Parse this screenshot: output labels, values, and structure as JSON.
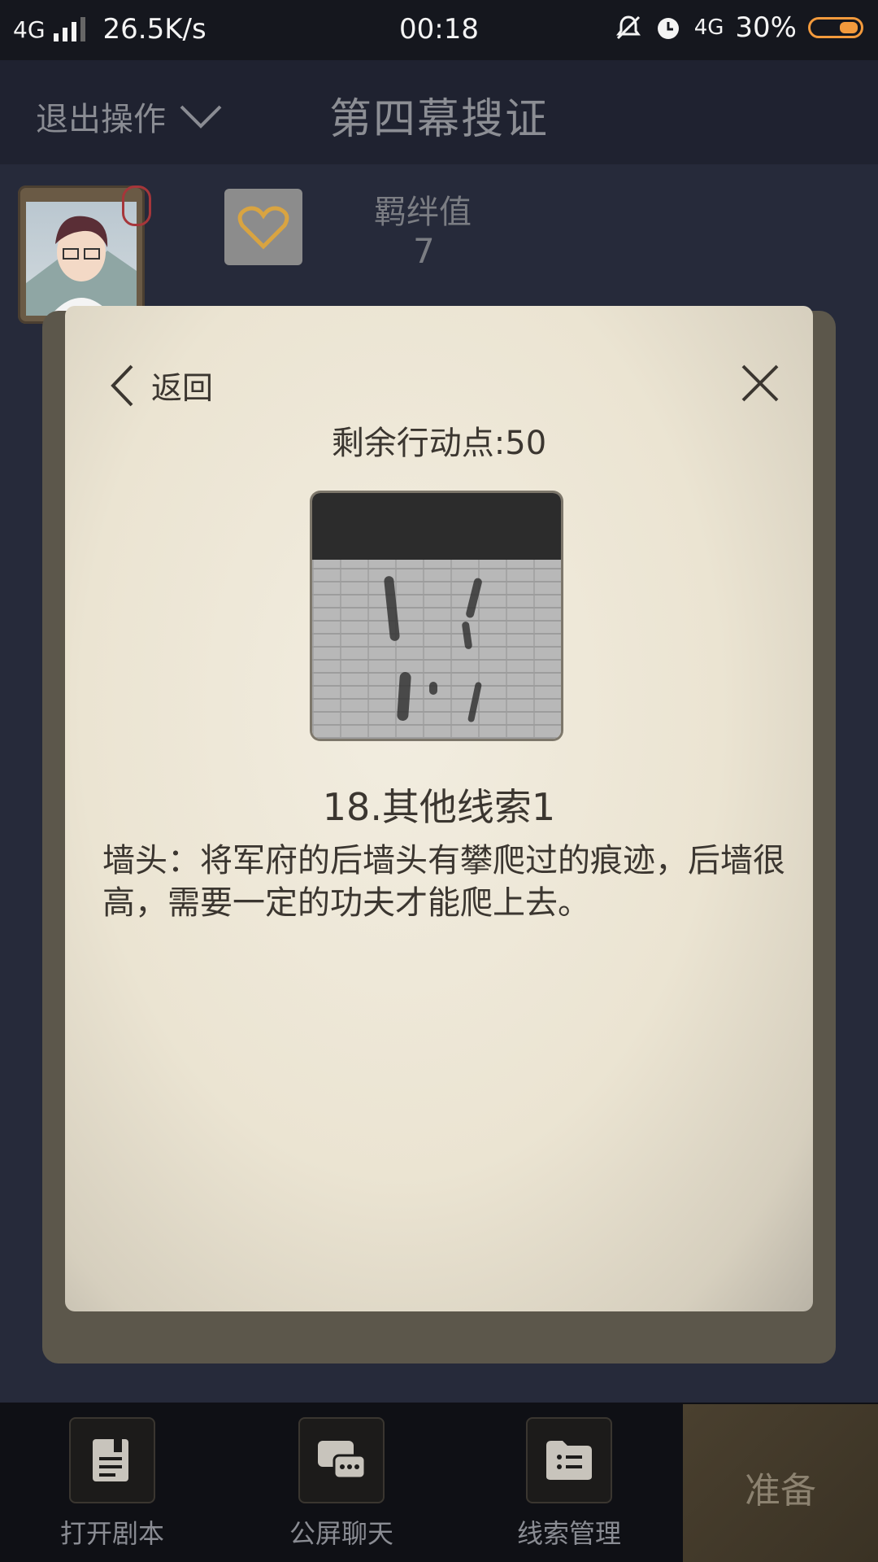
{
  "status_bar": {
    "network": "4G",
    "speed": "26.5K/s",
    "time": "00:18",
    "network2": "4G",
    "battery": "30%"
  },
  "header": {
    "exit_label": "退出操作",
    "title": "第四幕搜证"
  },
  "character": {
    "bond_label": "羁绊值",
    "bond_value": "7"
  },
  "modal": {
    "back_label": "返回",
    "remaining_action_points": "剩余行动点:50",
    "clue_title": "18.其他线索1",
    "clue_description": "墙头：将军府的后墙头有攀爬过的痕迹，后墙很高，需要一定的功夫才能爬上去。"
  },
  "bottom_nav": {
    "items": [
      {
        "label": "打开剧本",
        "icon": "script-icon"
      },
      {
        "label": "公屏聊天",
        "icon": "chat-icon"
      },
      {
        "label": "线索管理",
        "icon": "clue-folder-icon"
      }
    ],
    "ready_label": "准备"
  },
  "colors": {
    "accent_heart": "#d9a441",
    "battery": "#f39a3c",
    "paper": "#ebe4d2"
  }
}
